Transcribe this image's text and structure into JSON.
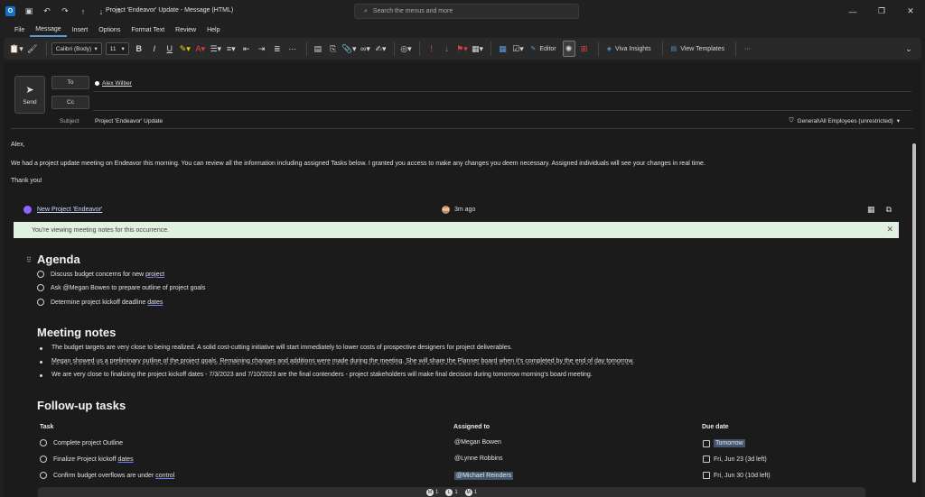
{
  "titlebar": {
    "title": "Project 'Endeavor' Update  -  Message (HTML)",
    "search_placeholder": "Search the menus and more"
  },
  "menu": [
    "File",
    "Message",
    "Insert",
    "Options",
    "Format Text",
    "Review",
    "Help"
  ],
  "ribbon": {
    "font_name": "Calibri (Body)",
    "font_size": "11",
    "editor": "Editor",
    "viva": "Viva Insights",
    "templates": "View Templates",
    "more": "···"
  },
  "header": {
    "send": "Send",
    "to_label": "To",
    "cc_label": "Cc",
    "recipient": "Alex Wilber",
    "subject_label": "Subject",
    "subject": "Project 'Endeavor' Update",
    "sensitivity": "General\\All Employees (unrestricted)"
  },
  "body": {
    "greeting": "Alex,",
    "paragraph": "We had a project update meeting on Endeavor this morning. You can review all the information including assigned Tasks below. I granted you access to make any changes you deem necessary. Assigned individuals will see your changes in real time.",
    "closing": "Thank you!"
  },
  "loop": {
    "title": "New Project 'Endeavor'",
    "time": "3m ago",
    "avatar_initials": "AW",
    "banner": "You're viewing meeting notes for this occurrence."
  },
  "agenda": {
    "heading": "Agenda",
    "items": [
      {
        "pre": "Discuss budget concerns for new ",
        "ul": "project",
        "post": ""
      },
      {
        "pre": "Ask @Megan Bowen to prepare outline of project goals",
        "ul": "",
        "post": ""
      },
      {
        "pre": "Determine project kickoff deadline ",
        "ul": "dates",
        "post": ""
      }
    ]
  },
  "notes": {
    "heading": "Meeting notes",
    "items": [
      "The budget targets are very close to being realized. A solid cost-cutting initiative will start immediately to lower costs of prospective designers for project deliverables.",
      "Megan showed us a preliminary outline of the project goals. Remaining changes and additions were made during the meeting. She will share the Planner board when it's completed by the end of day tomorrow.",
      "We are very close to finalizing the project kickoff dates - 7/3/2023 and 7/10/2023 are the final contenders - project stakeholders will make final decision during tomorrow morning's board meeting."
    ]
  },
  "tasks": {
    "heading": "Follow-up tasks",
    "col_task": "Task",
    "col_assigned": "Assigned to",
    "col_due": "Due date",
    "rows": [
      {
        "task_pre": "Complete project Outline",
        "task_ul": "",
        "assigned": "@Megan Bowen",
        "due": "Tomorrow"
      },
      {
        "task_pre": "Finalize Project kickoff ",
        "task_ul": "dates",
        "assigned": "@Lynne Robbins",
        "due": "Fri, Jun 23 (3d left)"
      },
      {
        "task_pre": "Confirm budget overflows are under ",
        "task_ul": "control",
        "assigned": "@Michael Reinders",
        "due": "Fri, Jun 30 (10d left)"
      }
    ]
  },
  "presence": [
    {
      "initial": "M",
      "count": "1"
    },
    {
      "initial": "L",
      "count": "1"
    },
    {
      "initial": "M",
      "count": "1"
    }
  ],
  "colors": {
    "accent": "#5b9bd5",
    "banner_bg": "#e0f2df",
    "background": "#1b1b1b"
  }
}
